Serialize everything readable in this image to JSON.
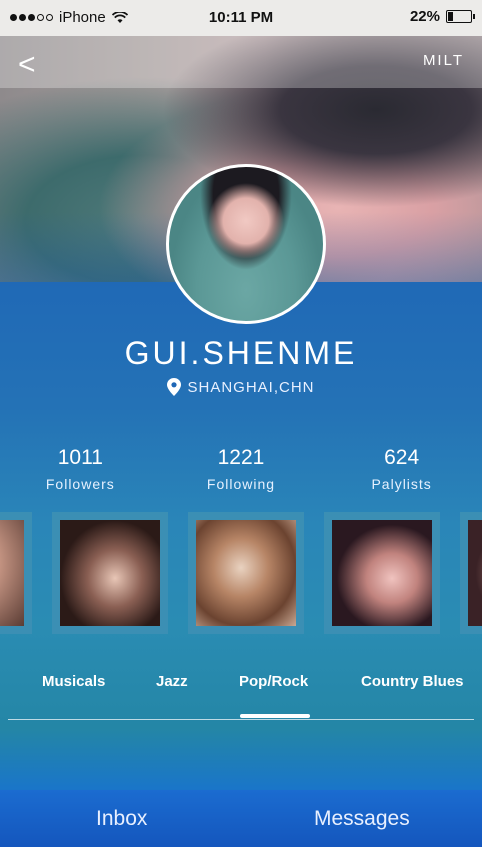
{
  "status_bar": {
    "carrier": "iPhone",
    "time": "10:11 PM",
    "battery": "22%",
    "battery_level": 0.22
  },
  "header": {
    "back_icon": "<",
    "action_label": "MILT"
  },
  "profile": {
    "name": "GUI.SHENME",
    "location": "SHANGHAI,CHN"
  },
  "stats": [
    {
      "value": "1011",
      "label": "Followers"
    },
    {
      "value": "1221",
      "label": "Following"
    },
    {
      "value": "624",
      "label": "Palylists"
    }
  ],
  "genres": {
    "items": [
      "Musicals",
      "Jazz",
      "Pop/Rock",
      "Country Blues"
    ],
    "selected": "Pop/Rock"
  },
  "tabbar": {
    "inbox": "Inbox",
    "messages": "Messages"
  },
  "icons": {
    "wifi": "wifi-icon",
    "battery": "battery-icon",
    "location": "location-pin-icon",
    "back": "back-chevron-icon"
  },
  "colors": {
    "primary": "#1e5fb0",
    "tabbar": "#1b6cd0",
    "text": "#ffffff"
  }
}
